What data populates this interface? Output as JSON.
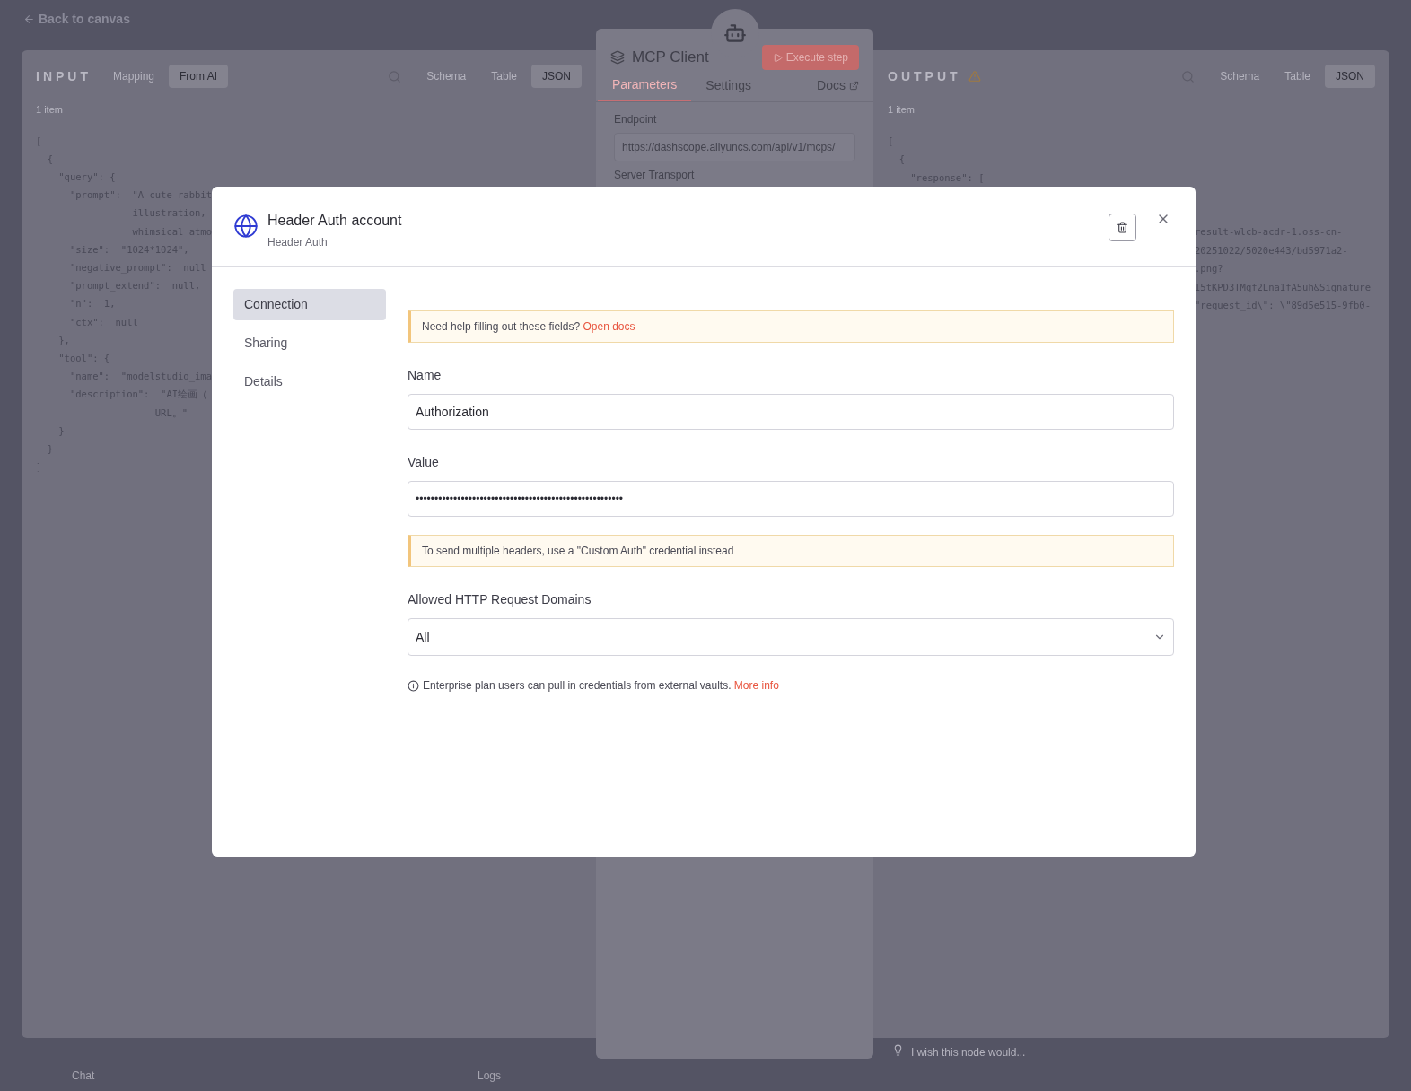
{
  "back_link": "Back to canvas",
  "input_panel": {
    "title": "INPUT",
    "mode_tabs": [
      {
        "label": "Mapping",
        "selected": false
      },
      {
        "label": "From AI",
        "selected": true
      }
    ],
    "view_tabs": [
      {
        "label": "Schema",
        "selected": false
      },
      {
        "label": "Table",
        "selected": false
      },
      {
        "label": "JSON",
        "selected": true
      }
    ],
    "count": "1 item",
    "code_lines": [
      "[",
      "  {",
      "    \"query\": {",
      "      \"prompt\":  \"A cute rabbit",
      "                 illustration,",
      "                 whimsical atmo",
      "      \"size\":  \"1024*1024\",",
      "      \"negative_prompt\":  null",
      "      \"prompt_extend\":  null,",
      "      \"n\":  1,",
      "      \"ctx\":  null",
      "    },",
      "    \"tool\": {",
      "      \"name\":  \"modelstudio_ima",
      "      \"description\":  \"AI绘画（",
      "                     URL。\"",
      "    }",
      "  }",
      "]"
    ]
  },
  "node_panel": {
    "title": "MCP Client",
    "execute_button": "Execute step",
    "tabs": [
      {
        "label": "Parameters",
        "selected": true
      },
      {
        "label": "Settings",
        "selected": false
      },
      {
        "label": "Docs",
        "selected": false
      }
    ],
    "endpoint_label": "Endpoint",
    "endpoint_value": "https://dashscope.aliyuncs.com/api/v1/mcps/",
    "transport_label": "Server Transport"
  },
  "output_panel": {
    "title": "OUTPUT",
    "view_tabs": [
      {
        "label": "Schema",
        "selected": false
      },
      {
        "label": "Table",
        "selected": false
      },
      {
        "label": "JSON",
        "selected": true
      }
    ],
    "count": "1 item",
    "code_lines": [
      {
        "kind": "full",
        "text": "["
      },
      {
        "kind": "full",
        "text": "  {"
      },
      {
        "kind": "full",
        "text": "    \"response\": ["
      },
      {
        "kind": "clipped",
        "text": "result-wlcb-acdr-1.oss-cn-"
      },
      {
        "kind": "clipped",
        "text": "20251022/5020e443/bd5971a2-"
      },
      {
        "kind": "clipped",
        "text": ".png?"
      },
      {
        "kind": "clipped",
        "text": "I5tKPD3TMqf2Lna1fA5uh&Signature"
      },
      {
        "kind": "clipped",
        "text": "\"request_id\\\": \\\"89d5e515-9fb0-"
      }
    ]
  },
  "footer": {
    "feedback_placeholder": "I wish this node would...",
    "chat": "Chat",
    "logs": "Logs"
  },
  "modal": {
    "title": "Header Auth account",
    "subtitle": "Header Auth",
    "nav": [
      {
        "label": "Connection",
        "selected": true
      },
      {
        "label": "Sharing",
        "selected": false
      },
      {
        "label": "Details",
        "selected": false
      }
    ],
    "help_notice": {
      "text": "Need help filling out these fields?",
      "link": "Open docs"
    },
    "name_field": {
      "label": "Name",
      "value": "Authorization"
    },
    "value_field": {
      "label": "Value",
      "value": "•••••••••••••••••••••••••••••••••••••••••••••••••••••••"
    },
    "headers_notice": "To send multiple headers, use a \"Custom Auth\" credential instead",
    "domains_field": {
      "label": "Allowed HTTP Request Domains",
      "value": "All"
    },
    "vault_note": {
      "text": "Enterprise plan users can pull in credentials from external vaults.",
      "link": "More info"
    }
  }
}
